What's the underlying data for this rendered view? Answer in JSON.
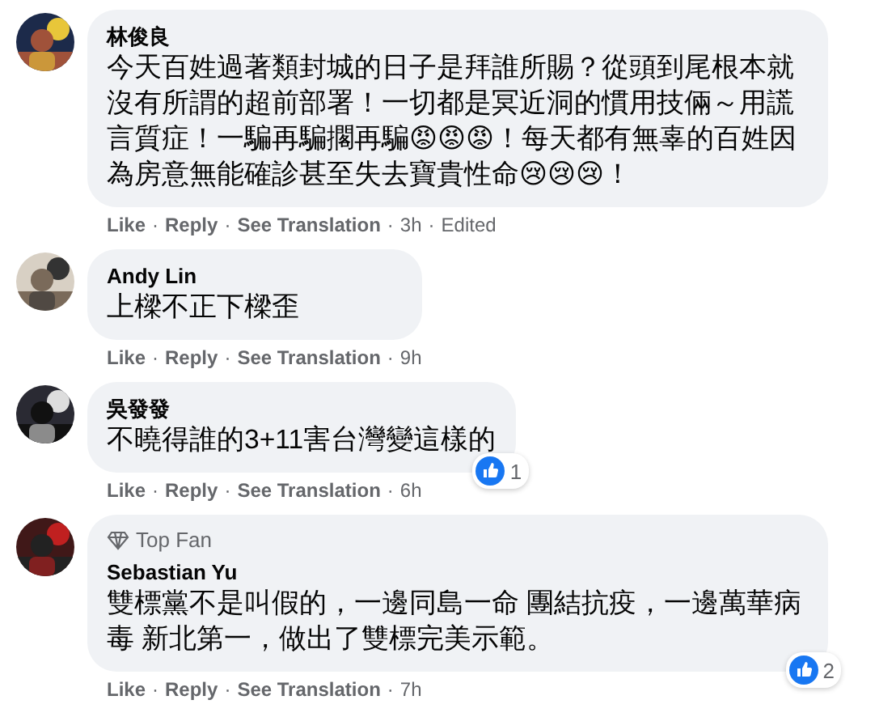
{
  "comments": [
    {
      "avatar": {
        "kind": "picture"
      },
      "name": "林俊良",
      "text": "今天百姓過著類封城的日子是拜誰所賜？從頭到尾根本就沒有所謂的超前部署！一切都是冥近洞的慣用技倆～用謊言質症！一騙再騙擱再騙😡😡😡！每天都有無辜的百姓因為房意無能確診甚至失去寶貴性命😢😢😢！",
      "actions": [
        {
          "kind": "link",
          "label": "Like"
        },
        {
          "kind": "link",
          "separator": "·",
          "label": "Reply"
        },
        {
          "kind": "link",
          "separator": "·",
          "label": "See Translation"
        },
        {
          "kind": "time",
          "separator": "·",
          "label": "3h"
        },
        {
          "kind": "note",
          "separator": "·",
          "label": "Edited"
        }
      ]
    },
    {
      "avatar": {
        "kind": "picture"
      },
      "name": "Andy Lin",
      "text": "上樑不正下樑歪",
      "actions": [
        {
          "kind": "link",
          "label": "Like"
        },
        {
          "kind": "link",
          "separator": "·",
          "label": "Reply"
        },
        {
          "kind": "link",
          "separator": "·",
          "label": "See Translation"
        },
        {
          "kind": "time",
          "separator": "·",
          "label": "9h"
        }
      ]
    },
    {
      "avatar": {
        "kind": "picture"
      },
      "name": "吳發發",
      "text": "不曉得誰的3+11害台灣變這樣的",
      "reactions": {
        "count": "1"
      },
      "actions": [
        {
          "kind": "link",
          "label": "Like"
        },
        {
          "kind": "link",
          "separator": "·",
          "label": "Reply"
        },
        {
          "kind": "link",
          "separator": "·",
          "label": "See Translation"
        },
        {
          "kind": "time",
          "separator": "·",
          "label": "6h"
        }
      ]
    },
    {
      "avatar": {
        "kind": "picture"
      },
      "badge": "Top Fan",
      "name": "Sebastian Yu",
      "text": "雙標黨不是叫假的，一邊同島一命 團結抗疫，一邊萬華病毒 新北第一，做出了雙標完美示範。",
      "reactions": {
        "count": "2"
      },
      "actions": [
        {
          "kind": "link",
          "label": "Like"
        },
        {
          "kind": "link",
          "separator": "·",
          "label": "Reply"
        },
        {
          "kind": "link",
          "separator": "·",
          "label": "See Translation"
        },
        {
          "kind": "time",
          "separator": "·",
          "label": "7h"
        }
      ]
    }
  ]
}
